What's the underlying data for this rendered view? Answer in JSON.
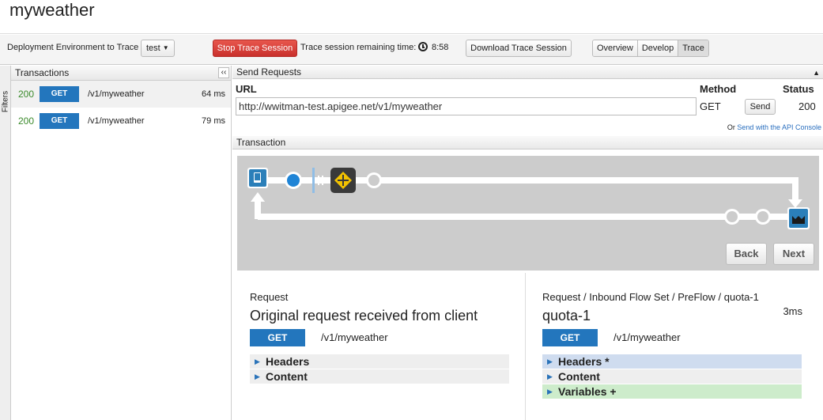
{
  "app": {
    "title": "myweather"
  },
  "toolbar": {
    "env_label": "Deployment Environment to Trace",
    "env_value": "test",
    "stop_label": "Stop Trace Session",
    "remaining_label": "Trace session remaining time:",
    "remaining_time": "8:58",
    "download_label": "Download Trace Session",
    "tabs": [
      "Overview",
      "Develop",
      "Trace"
    ],
    "active_tab": "Trace"
  },
  "filters": {
    "label": "Filters"
  },
  "transactions": {
    "header": "Transactions",
    "collapse": "‹‹",
    "rows": [
      {
        "status": "200",
        "method": "GET",
        "path": "/v1/myweather",
        "time": "64 ms"
      },
      {
        "status": "200",
        "method": "GET",
        "path": "/v1/myweather",
        "time": "79 ms"
      }
    ]
  },
  "send": {
    "header": "Send Requests",
    "url_label": "URL",
    "method_label": "Method",
    "status_label": "Status",
    "url": "http://wwitman-test.apigee.net/v1/myweather",
    "method": "GET",
    "send_label": "Send",
    "status": "200",
    "or": "Or",
    "console_link": "Send with the API Console"
  },
  "transaction": {
    "header": "Transaction",
    "back_label": "Back",
    "next_label": "Next"
  },
  "request": {
    "path": "Request",
    "title": "Original request received from client",
    "method": "GET",
    "url": "/v1/myweather",
    "sections": [
      "Headers",
      "Content"
    ]
  },
  "step": {
    "path": "Request / Inbound Flow Set / PreFlow / quota-1",
    "time": "3ms",
    "title": "quota-1",
    "method": "GET",
    "url": "/v1/myweather",
    "sections": [
      "Headers *",
      "Content",
      "Variables +"
    ]
  },
  "colors": {
    "accent": "#2376bd",
    "stop": "#d9403a",
    "status_ok": "#3a8a2a",
    "policy": "#f2c200"
  }
}
